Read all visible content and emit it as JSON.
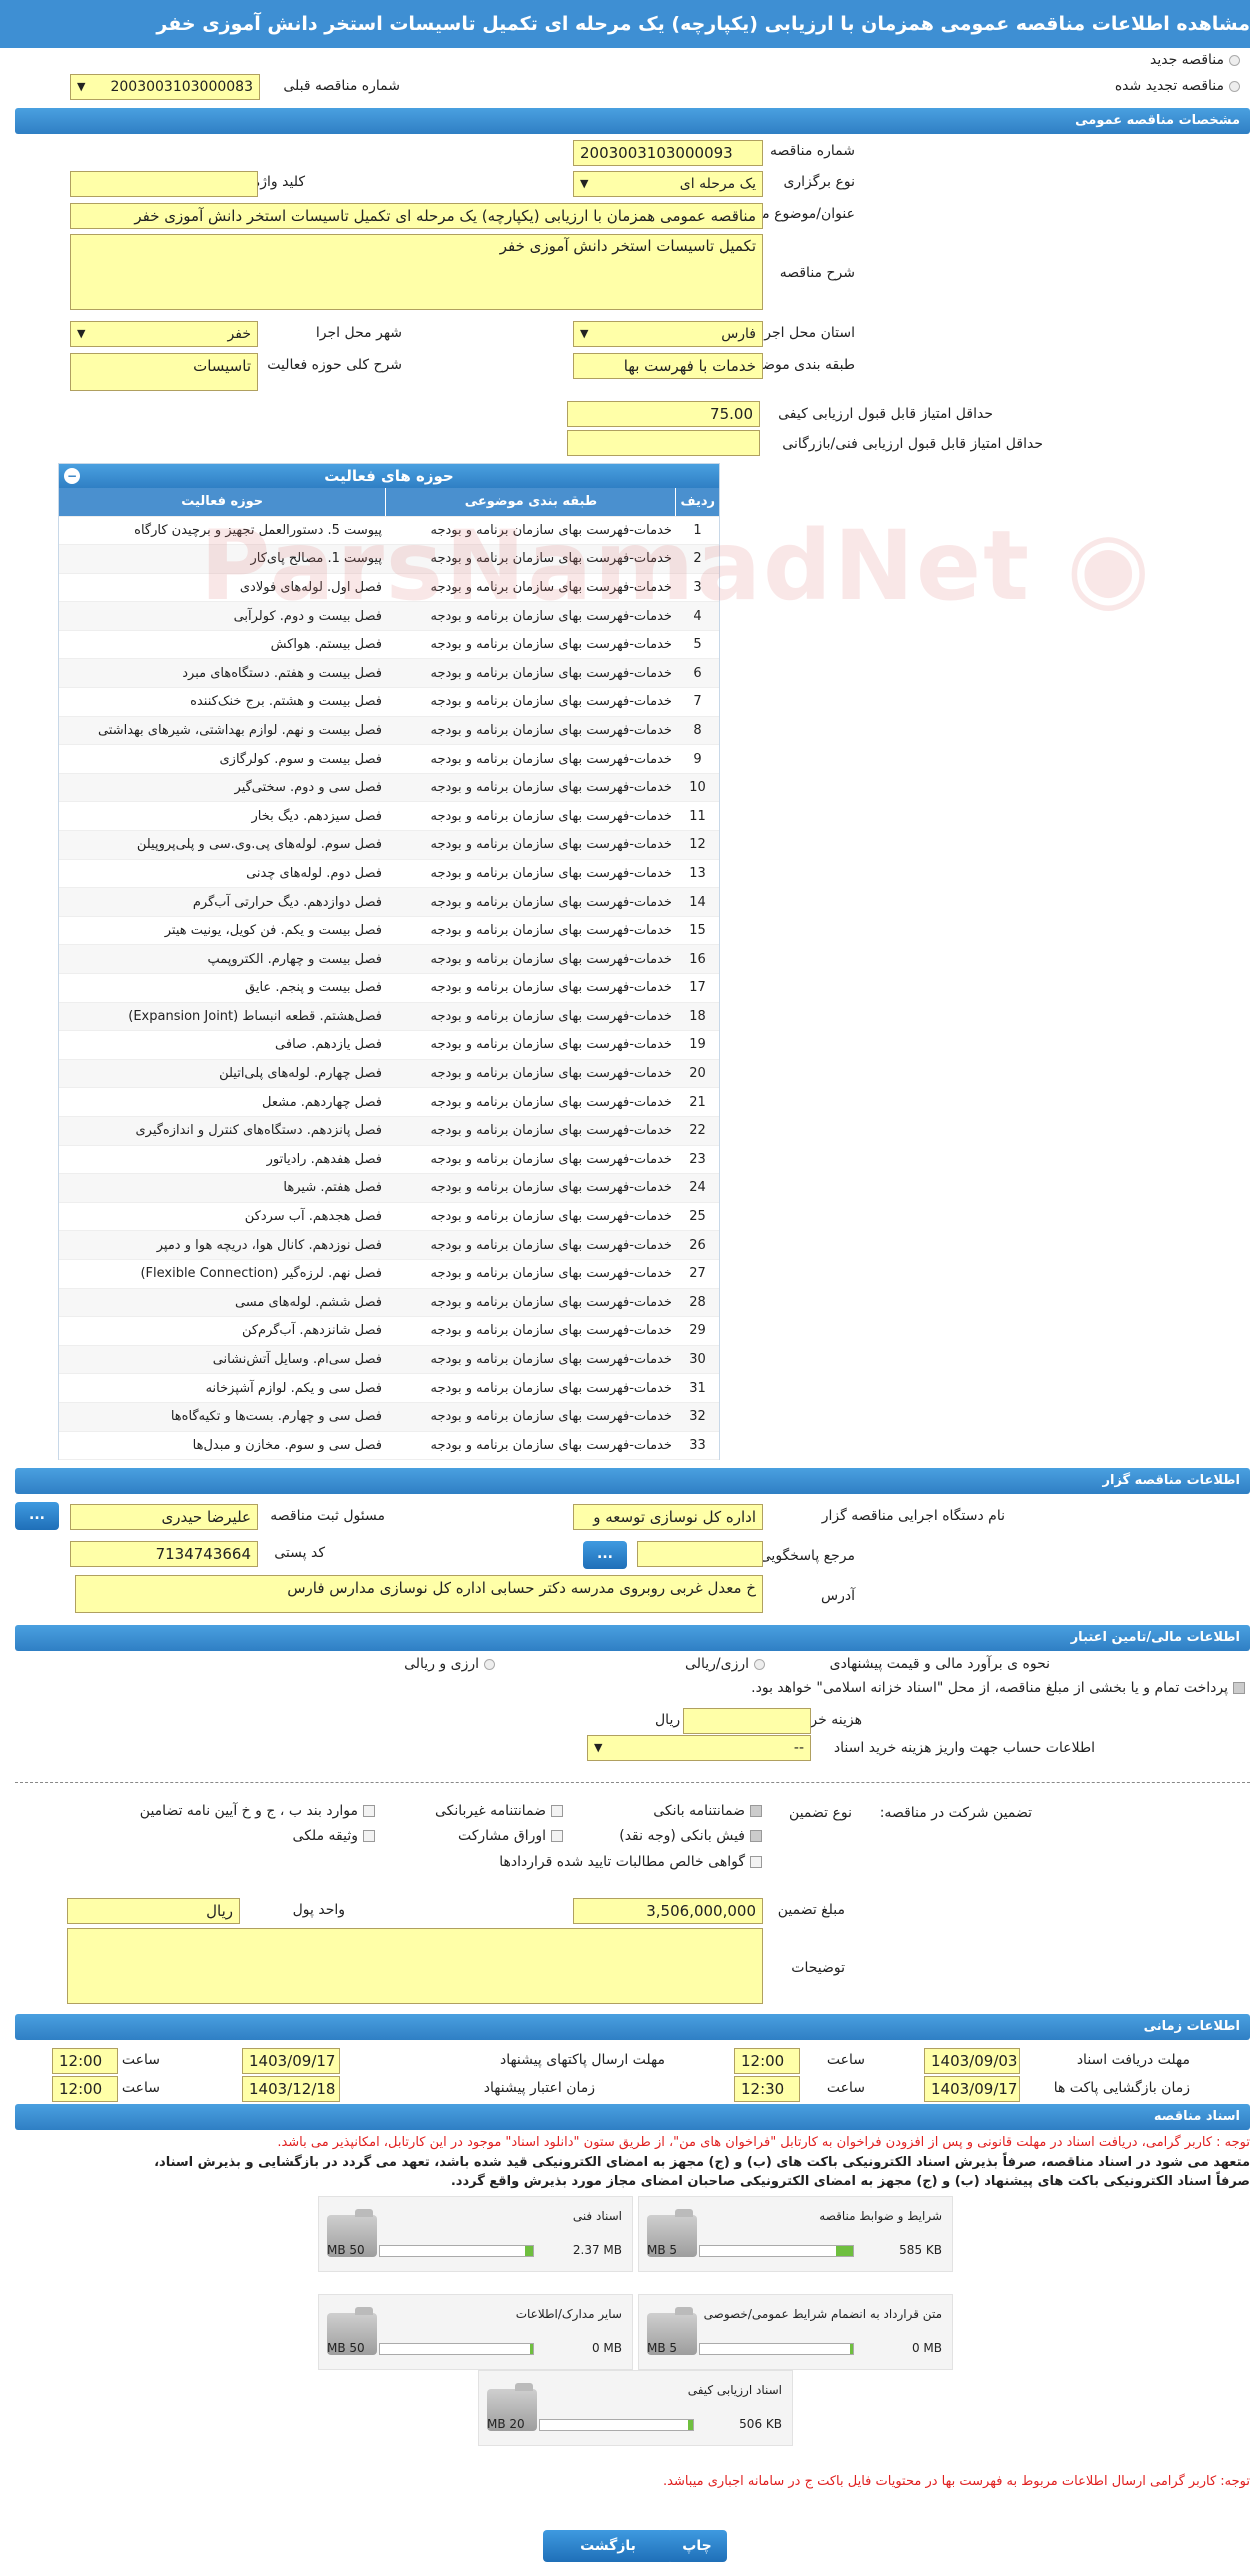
{
  "header": {
    "title": "مشاهده اطلاعات مناقصه عمومی همزمان با ارزیابی (یکپارچه) یک مرحله ای تکمیل تاسیسات استخر دانش آموزی خفر"
  },
  "top": {
    "new_tender": "مناقصه جدید",
    "renewed_tender": "مناقصه تجدید شده",
    "prev_no_label": "شماره مناقصه قبلی",
    "prev_no": "2003003103000083"
  },
  "general": {
    "title": "مشخصات مناقصه عمومی",
    "no_label": "شماره مناقصه",
    "no": "2003003103000093",
    "type_label": "نوع برگزاری",
    "type": "یک مرحله ای",
    "keyword_label": "کلید واژه",
    "keyword": "",
    "subject_label": "عنوان/موضوع مناقصه",
    "subject": "مناقصه عمومی همزمان با ارزیابی (یکپارچه) یک مرحله ای تکمیل تاسیسات استخر دانش آموزی خفر",
    "desc_label": "شرح مناقصه",
    "desc": "تکمیل تاسیسات استخر دانش آموزی خفر",
    "province_label": "استان محل اجرا",
    "province": "فارس",
    "city_label": "شهر محل اجرا",
    "city": "خفر",
    "category_label": "طبقه بندی موضوعی",
    "category": "خدمات با فهرست بها",
    "activity_label": "شرح کلی حوزه فعالیت",
    "activity": "تاسیسات",
    "min_quality_label": "حداقل امتیاز قابل قبول ارزیابی کیفی",
    "min_quality": "75.00",
    "min_tech_label": "حداقل امتیاز قابل قبول ارزیابی فنی/بازرگانی",
    "min_tech": ""
  },
  "activities": {
    "title": "حوزه های فعالیت",
    "col_row": "ردیف",
    "col_cat": "طبقه بندی موضوعی",
    "col_field": "حوزه فعالیت",
    "rows": [
      [
        "1",
        "خدمات-فهرست بهای سازمان برنامه و بودجه",
        "پیوست 5. دستورالعمل تجهیز و برچیدن کارگاه"
      ],
      [
        "2",
        "خدمات-فهرست بهای سازمان برنامه و بودجه",
        "پیوست 1. مصالح پای‌کار"
      ],
      [
        "3",
        "خدمات-فهرست بهای سازمان برنامه و بودجه",
        "فصل اول. لوله‌های فولادی"
      ],
      [
        "4",
        "خدمات-فهرست بهای سازمان برنامه و بودجه",
        "فصل بیست و دوم. کولرآبی"
      ],
      [
        "5",
        "خدمات-فهرست بهای سازمان برنامه و بودجه",
        "فصل بیستم. هواکش"
      ],
      [
        "6",
        "خدمات-فهرست بهای سازمان برنامه و بودجه",
        "فصل بیست و هفتم. دستگاه‌های مبرد"
      ],
      [
        "7",
        "خدمات-فهرست بهای سازمان برنامه و بودجه",
        "فصل بیست و هشتم. برج خنک‌کننده"
      ],
      [
        "8",
        "خدمات-فهرست بهای سازمان برنامه و بودجه",
        "فصل بیست و نهم. لوازم بهداشتی، شیرهای بهداشتی"
      ],
      [
        "9",
        "خدمات-فهرست بهای سازمان برنامه و بودجه",
        "فصل بیست و سوم. کولرگازی"
      ],
      [
        "10",
        "خدمات-فهرست بهای سازمان برنامه و بودجه",
        "فصل سی و دوم. سختی‌گیر"
      ],
      [
        "11",
        "خدمات-فهرست بهای سازمان برنامه و بودجه",
        "فصل سیزدهم. دیگ بخار"
      ],
      [
        "12",
        "خدمات-فهرست بهای سازمان برنامه و بودجه",
        "فصل سوم. لوله‌های پی.وی.سی و پلی‌پروپیلن"
      ],
      [
        "13",
        "خدمات-فهرست بهای سازمان برنامه و بودجه",
        "فصل دوم. لوله‌های چدنی"
      ],
      [
        "14",
        "خدمات-فهرست بهای سازمان برنامه و بودجه",
        "فصل دوازدهم. دیگ حرارتی آب‌گرم"
      ],
      [
        "15",
        "خدمات-فهرست بهای سازمان برنامه و بودجه",
        "فصل بیست و یکم. فن کویل، یونیت هیتر"
      ],
      [
        "16",
        "خدمات-فهرست بهای سازمان برنامه و بودجه",
        "فصل بیست و چهارم. الکتروپمپ"
      ],
      [
        "17",
        "خدمات-فهرست بهای سازمان برنامه و بودجه",
        "فصل بیست و پنجم. عایق"
      ],
      [
        "18",
        "خدمات-فهرست بهای سازمان برنامه و بودجه",
        "فصل‌هشتم. قطعه انبساط (Expansion Joint)"
      ],
      [
        "19",
        "خدمات-فهرست بهای سازمان برنامه و بودجه",
        "فصل یازدهم. صافی"
      ],
      [
        "20",
        "خدمات-فهرست بهای سازمان برنامه و بودجه",
        "فصل چهارم. لوله‌های پلی‌اتیلن"
      ],
      [
        "21",
        "خدمات-فهرست بهای سازمان برنامه و بودجه",
        "فصل چهاردهم. مشعل"
      ],
      [
        "22",
        "خدمات-فهرست بهای سازمان برنامه و بودجه",
        "فصل پانزدهم. دستگاه‌های کنترل و اندازه‌گیری"
      ],
      [
        "23",
        "خدمات-فهرست بهای سازمان برنامه و بودجه",
        "فصل هفدهم. رادیاتور"
      ],
      [
        "24",
        "خدمات-فهرست بهای سازمان برنامه و بودجه",
        "فصل هفتم. شیرها"
      ],
      [
        "25",
        "خدمات-فهرست بهای سازمان برنامه و بودجه",
        "فصل هجدهم. آب سردکن"
      ],
      [
        "26",
        "خدمات-فهرست بهای سازمان برنامه و بودجه",
        "فصل نوزدهم. کانال هوا، دریچه هوا و دمپر"
      ],
      [
        "27",
        "خدمات-فهرست بهای سازمان برنامه و بودجه",
        "فصل نهم. لرزه‌گیر (Flexible Connection)"
      ],
      [
        "28",
        "خدمات-فهرست بهای سازمان برنامه و بودجه",
        "فصل ششم. لوله‌های مسی"
      ],
      [
        "29",
        "خدمات-فهرست بهای سازمان برنامه و بودجه",
        "فصل شانزدهم. آب‌گرم‌کن"
      ],
      [
        "30",
        "خدمات-فهرست بهای سازمان برنامه و بودجه",
        "فصل سی‌ام. وسایل آتش‌نشانی"
      ],
      [
        "31",
        "خدمات-فهرست بهای سازمان برنامه و بودجه",
        "فصل سی و یکم. لوازم آشپزخانه"
      ],
      [
        "32",
        "خدمات-فهرست بهای سازمان برنامه و بودجه",
        "فصل سی و چهارم. بست‌ها و تکیه‌گاه‌ها"
      ],
      [
        "33",
        "خدمات-فهرست بهای سازمان برنامه و بودجه",
        "فصل سی و سوم. مخازن و مبدل‌ها"
      ]
    ]
  },
  "organizer": {
    "title": "اطلاعات مناقصه گزار",
    "org_label": "نام دستگاه اجرایی مناقصه گزار",
    "org": "اداره کل نوسازی   توسعه و",
    "resp_label": "مسئول ثبت مناقصه",
    "resp": "علیرضا حیدری",
    "ref_label": "مرجع پاسخگویی",
    "ref": "",
    "postal_label": "کد پستی",
    "postal": "7134743664",
    "address_label": "آدرس",
    "address": "خ معدل غربی روبروی مدرسه دکتر حسابی اداره کل نوسازی مدارس فارس",
    "more": "..."
  },
  "finance": {
    "title": "اطلاعات مالی/تامین اعتبار",
    "estimate_label": "نحوه ی برآورد مالی و قیمت پیشنهادی",
    "opt1": "ارزی/ریالی",
    "opt2": "ارزی و ریالی",
    "treasury": "پرداخت تمام و یا بخشی از مبلغ مناقصه، از محل \"اسناد خزانه اسلامی\" خواهد بود.",
    "doc_cost_label": "هزینه خرید اسناد",
    "currency": "ریال",
    "account_label": "اطلاعات حساب جهت واریز هزینه خرید اسناد",
    "account_val": "--"
  },
  "guarantee": {
    "label": "تضمین شرکت در مناقصه:",
    "type_label": "نوع تضمین",
    "g1": "ضمانتنامه بانکی",
    "g2": "ضمانتنامه غیربانکی",
    "g3": "موارد بند ب ، ج و خ آیین نامه تضامین",
    "g4": "فیش بانکی (وجه نقد)",
    "g5": "اوراق مشارکت",
    "g6": "وثیقه ملکی",
    "g7": "گواهی خالص مطالبات تایید شده قراردادها",
    "amount_label": "مبلغ تضمین",
    "amount": "3,506,000,000",
    "unit_label": "واحد پول",
    "unit": "ریال",
    "notes_label": "توضیحات",
    "notes": ""
  },
  "timing": {
    "title": "اطلاعات زمانی",
    "doc_deadline_label": "مهلت دریافت اسناد",
    "doc_deadline_date": "1403/09/03",
    "doc_deadline_time": "12:00",
    "submit_label": "مهلت ارسال پاکتهای پیشنهاد",
    "submit_date": "1403/09/17",
    "submit_time": "12:00",
    "open_label": "زمان بازگشایی پاکت ها",
    "open_date": "1403/09/17",
    "open_time": "12:30",
    "valid_label": "زمان اعتبار پیشنهاد",
    "valid_date": "1403/12/18",
    "valid_time": "12:00",
    "time_label": "ساعت"
  },
  "docs": {
    "title": "اسناد مناقصه",
    "note1": "توجه : کاربر گرامی، دریافت اسناد در مهلت قانونی و پس از افزودن فراخوان به کارتابل \"فراخوان های من\"، از طریق ستون \"دانلود اسناد\" موجود در این کارتابل، امکانپذیر می باشد.",
    "note2": "متعهد می شود در اسناد مناقصه، صرفاً بذیرش اسناد الکترونیکی باکت های (ب) و (ج) مجهز به امضای الکترونیکی قید شده باشد، تعهد می گردد در بازگشایی و بذیرش اسناد،",
    "note3": "صرفاً اسناد الکترونیکی باکت های پیشنهاد (ب) و (ج) مجهز به امضای الکترونیکی صاحبان امضای مجاز مورد بذیرش واقع گردد.",
    "files": [
      {
        "name": "شرایط و ضوابط مناقصه",
        "used": "585 KB",
        "max": "5 MB",
        "fill": 0.11
      },
      {
        "name": "اسناد فنی",
        "used": "2.37 MB",
        "max": "50 MB",
        "fill": 0.05
      },
      {
        "name": "متن قرارداد به انضمام شرایط عمومی/خصوصی",
        "used": "0 MB",
        "max": "5 MB",
        "fill": 0
      },
      {
        "name": "سایر مدارک/اطلاعات",
        "used": "0 MB",
        "max": "50 MB",
        "fill": 0
      },
      {
        "name": "اسناد ارزیابی کیفی",
        "used": "506 KB",
        "max": "20 MB",
        "fill": 0.03
      }
    ],
    "note4": "توجه: کاربر گرامی ارسال اطلاعات مربوط به فهرست بها در محتویات فایل باکت ج در سامانه اجباری میباشد."
  },
  "actions": {
    "back": "بازگشت",
    "print": "چاپ"
  },
  "colors": {
    "header": "#3e8fd3",
    "field": "#ffffa8",
    "warn": "#e02020"
  }
}
